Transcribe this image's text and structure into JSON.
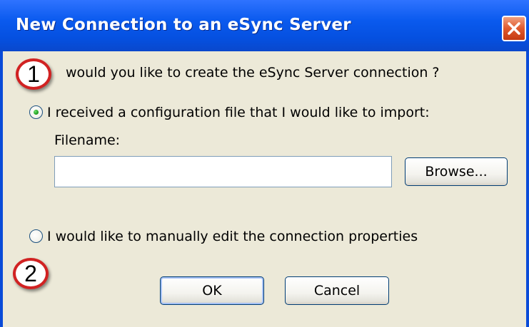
{
  "window": {
    "title": "New Connection to an eSync Server",
    "close_icon": "close-x-icon",
    "colors": {
      "titlebar": "#0550E0",
      "client": "#ECE9D8",
      "close_button": "#E05A2E",
      "badge_ring": "#D12222"
    }
  },
  "annotations": {
    "step1": "1",
    "step2": "2"
  },
  "question": "would you like to create the eSync Server connection ?",
  "options": {
    "import_label": "I received a configuration file that I would like to import:",
    "import_selected": true,
    "manual_label": "I would like to manually edit the connection properties",
    "manual_selected": false
  },
  "filename": {
    "label": "Filename:",
    "value": "",
    "placeholder": ""
  },
  "buttons": {
    "browse": "Browse...",
    "ok": "OK",
    "cancel": "Cancel"
  }
}
